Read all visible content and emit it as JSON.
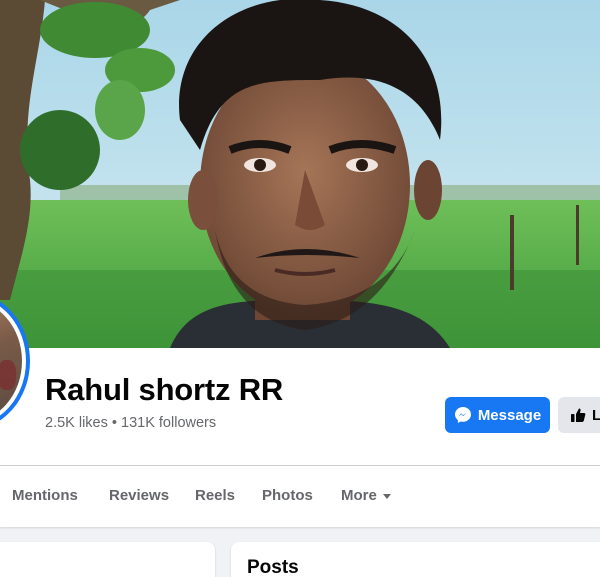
{
  "profile": {
    "name": "Rahul shortz RR",
    "likes": "2.5K likes",
    "separator": " • ",
    "followers": "131K followers"
  },
  "actions": {
    "message_label": "Message",
    "message_icon": "messenger-icon",
    "like_label": "Like",
    "like_icon": "thumbs-up-icon"
  },
  "tabs": [
    {
      "label": "Mentions"
    },
    {
      "label": "Reviews"
    },
    {
      "label": "Reels"
    },
    {
      "label": "Photos"
    },
    {
      "label": "More",
      "icon": "caret-down-icon"
    }
  ],
  "sections": {
    "posts_title": "Posts"
  },
  "colors": {
    "accent": "#1877f2",
    "background": "#f0f2f5",
    "secondary_text": "#65676b",
    "button_gray": "#e4e6eb"
  }
}
